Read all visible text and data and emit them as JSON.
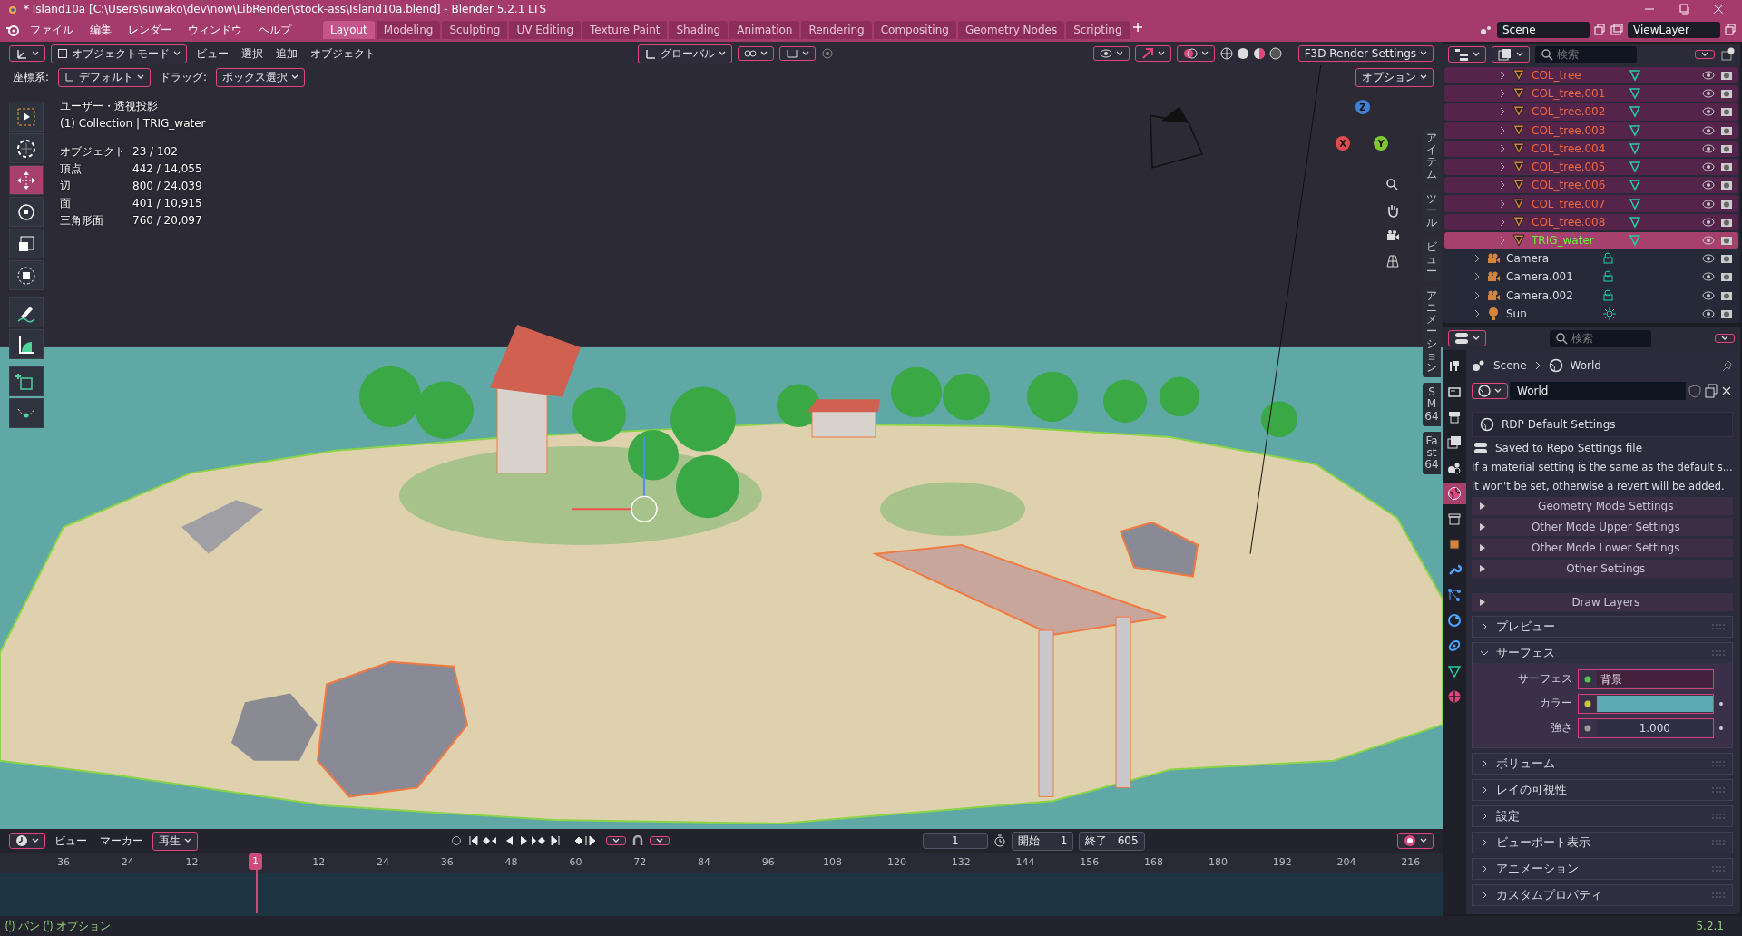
{
  "title_bar": {
    "title": "* Island10a [C:\\Users\\suwako\\dev\\now\\LibRender\\stock-ass\\Island10a.blend] - Blender 5.2.1 LTS"
  },
  "menu_bar": {
    "menus": [
      "ファイル",
      "編集",
      "レンダー",
      "ウィンドウ",
      "ヘルプ"
    ],
    "workspaces": [
      {
        "label": "Layout",
        "selected": true
      },
      {
        "label": "Modeling",
        "selected": false
      },
      {
        "label": "Sculpting",
        "selected": false
      },
      {
        "label": "UV Editing",
        "selected": false
      },
      {
        "label": "Texture Paint",
        "selected": false
      },
      {
        "label": "Shading",
        "selected": false
      },
      {
        "label": "Animation",
        "selected": false
      },
      {
        "label": "Rendering",
        "selected": false
      },
      {
        "label": "Compositing",
        "selected": false
      },
      {
        "label": "Geometry Nodes",
        "selected": false
      },
      {
        "label": "Scripting",
        "selected": false
      }
    ],
    "scene": "Scene",
    "view_layer": "ViewLayer"
  },
  "viewport": {
    "header": {
      "mode": "オブジェクトモード",
      "menus": [
        "ビュー",
        "選択",
        "追加",
        "オブジェクト"
      ],
      "orientation": "グローバル",
      "render_settings": "F3D Render Settings"
    },
    "tool_settings": {
      "coord_label": "座標系:",
      "coord_value": "デフォルト",
      "drag_label": "ドラッグ:",
      "drag_value": "ボックス選択",
      "options": "オプション"
    },
    "view_name": "ユーザー・透視投影",
    "context": "(1) Collection | TRIG_water",
    "stats": [
      {
        "label": "オブジェクト",
        "value": "23 / 102"
      },
      {
        "label": "頂点",
        "value": "442 / 14,055"
      },
      {
        "label": "辺",
        "value": "800 / 24,039"
      },
      {
        "label": "面",
        "value": "401 / 10,915"
      },
      {
        "label": "三角形面",
        "value": "760 / 20,097"
      }
    ],
    "tools": [
      {
        "kind": "select",
        "selected": false
      },
      {
        "kind": "cursor",
        "selected": false
      },
      {
        "kind": "move",
        "selected": true
      },
      {
        "kind": "rotate",
        "selected": false
      },
      {
        "kind": "scale",
        "selected": false
      },
      {
        "kind": "transform",
        "selected": false
      },
      {
        "kind": "annotate",
        "selected": false
      },
      {
        "kind": "measure",
        "selected": false
      },
      {
        "kind": "add-cube",
        "selected": false
      },
      {
        "kind": "curve",
        "selected": false
      }
    ],
    "side_tabs": [
      "アイテム",
      "ツール",
      "ビュー",
      "アニメーション",
      "SM64",
      "Fast64"
    ],
    "axis_labels": [
      "Z",
      "X",
      "Y"
    ]
  },
  "outliner": {
    "search_placeholder": "検索",
    "nested_rows": [
      {
        "name": "COL_tree",
        "kind": "mesh",
        "selected": true,
        "active": false
      },
      {
        "name": "COL_tree.001",
        "kind": "mesh",
        "selected": true,
        "active": false
      },
      {
        "name": "COL_tree.002",
        "kind": "mesh",
        "selected": true,
        "active": false
      },
      {
        "name": "COL_tree.003",
        "kind": "mesh",
        "selected": true,
        "active": false
      },
      {
        "name": "COL_tree.004",
        "kind": "mesh",
        "selected": true,
        "active": false
      },
      {
        "name": "COL_tree.005",
        "kind": "mesh",
        "selected": true,
        "active": false
      },
      {
        "name": "COL_tree.006",
        "kind": "mesh",
        "selected": true,
        "active": false
      },
      {
        "name": "COL_tree.007",
        "kind": "mesh",
        "selected": true,
        "active": false
      },
      {
        "name": "COL_tree.008",
        "kind": "mesh",
        "selected": true,
        "active": false
      },
      {
        "name": "TRIG_water",
        "kind": "mesh",
        "selected": true,
        "active": true
      }
    ],
    "rows": [
      {
        "name": "Camera",
        "kind": "camera",
        "selected": false,
        "active": false
      },
      {
        "name": "Camera.001",
        "kind": "camera",
        "selected": false,
        "active": false
      },
      {
        "name": "Camera.002",
        "kind": "camera",
        "selected": false,
        "active": false
      },
      {
        "name": "Sun",
        "kind": "light",
        "selected": false,
        "active": false
      }
    ]
  },
  "properties": {
    "search_placeholder": "検索",
    "tabs": [
      {
        "kind": "tool",
        "selected": false
      },
      {
        "kind": "render",
        "selected": false
      },
      {
        "kind": "output",
        "selected": false
      },
      {
        "kind": "view-layer",
        "selected": false
      },
      {
        "kind": "scene",
        "selected": false
      },
      {
        "kind": "world",
        "selected": true
      },
      {
        "kind": "collection",
        "selected": false
      },
      {
        "kind": "object",
        "selected": false
      },
      {
        "kind": "modifier",
        "selected": false
      },
      {
        "kind": "particles",
        "selected": false
      },
      {
        "kind": "physics",
        "selected": false
      },
      {
        "kind": "constraints",
        "selected": false
      },
      {
        "kind": "data",
        "selected": false
      },
      {
        "kind": "material",
        "selected": false
      }
    ],
    "breadcrumb": [
      "Scene",
      "World"
    ],
    "datablock": "World",
    "addon_panel": {
      "title": "RDP Default Settings",
      "subtitle": "Saved to Repo Settings file",
      "note": [
        "If a material setting is the same as the default s...",
        "it won't be set, otherwise a revert will be added."
      ],
      "subpanels": [
        "Geometry Mode Settings",
        "Other Mode Upper Settings",
        "Other Mode Lower Settings",
        "Other Settings",
        "Draw Layers"
      ]
    },
    "sections": [
      {
        "label": "プレビュー",
        "expanded": false
      },
      {
        "label": "サーフェス",
        "expanded": true,
        "fields": [
          {
            "label": "サーフェス",
            "kind": "link",
            "value": "背景"
          },
          {
            "label": "カラー",
            "kind": "color",
            "color": "#5aaab2"
          },
          {
            "label": "強さ",
            "kind": "number",
            "value": "1.000"
          }
        ]
      },
      {
        "label": "ボリューム",
        "expanded": false
      },
      {
        "label": "レイの可視性",
        "expanded": false
      },
      {
        "label": "設定",
        "expanded": false
      },
      {
        "label": "ビューポート表示",
        "expanded": false
      },
      {
        "label": "アニメーション",
        "expanded": false
      },
      {
        "label": "カスタムプロパティ",
        "expanded": false
      }
    ]
  },
  "timeline": {
    "menus": [
      "ビュー",
      "マーカー"
    ],
    "playback": "再生",
    "current_frame": "1",
    "start_label": "開始",
    "start": "1",
    "end_label": "終了",
    "end": "605",
    "ticks": [
      "-36",
      "-24",
      "-12",
      "12",
      "24",
      "36",
      "48",
      "60",
      "72",
      "84",
      "96",
      "108",
      "120",
      "132",
      "144",
      "156",
      "168",
      "180",
      "192",
      "204",
      "216"
    ],
    "playhead": "1"
  },
  "status_bar": {
    "hints": [
      "パン",
      "オプション"
    ],
    "version": "5.2.1"
  }
}
